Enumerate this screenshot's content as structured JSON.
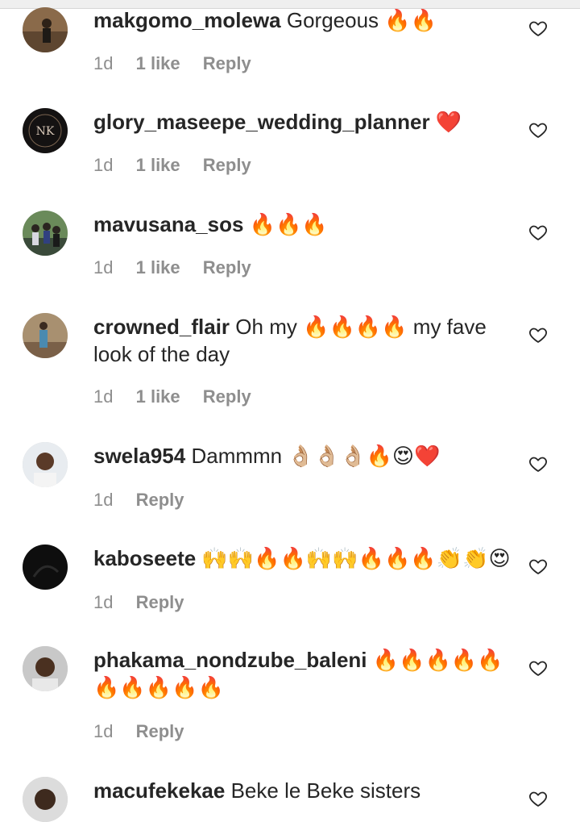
{
  "comments": [
    {
      "username": "makgomo_molewa",
      "text": "Gorgeous 🔥🔥",
      "time": "1d",
      "likes": "1 like",
      "reply_label": "Reply",
      "avatar": "person-outdoors-avatar"
    },
    {
      "username": "glory_maseepe_wedding_planner",
      "text": "❤️",
      "time": "1d",
      "likes": "1 like",
      "reply_label": "Reply",
      "avatar": "nk-logo-avatar"
    },
    {
      "username": "mavusana_sos",
      "text": "🔥🔥🔥",
      "time": "1d",
      "likes": "1 like",
      "reply_label": "Reply",
      "avatar": "group-photo-avatar"
    },
    {
      "username": "crowned_flair",
      "text": "Oh my 🔥🔥🔥🔥 my fave look of the day",
      "time": "1d",
      "likes": "1 like",
      "reply_label": "Reply",
      "avatar": "person-standing-avatar"
    },
    {
      "username": "swela954",
      "text": "Dammmn 👌🏼👌🏼👌🏼🔥😍❤️",
      "time": "1d",
      "likes": "",
      "reply_label": "Reply",
      "avatar": "portrait-avatar"
    },
    {
      "username": "kaboseete",
      "text": "🙌🙌🔥🔥🙌🙌🔥🔥🔥👏👏😍",
      "time": "1d",
      "likes": "",
      "reply_label": "Reply",
      "avatar": "dark-avatar"
    },
    {
      "username": "phakama_nondzube_baleni",
      "text": "🔥🔥🔥🔥🔥 🔥🔥🔥🔥🔥",
      "time": "1d",
      "likes": "",
      "reply_label": "Reply",
      "avatar": "face-avatar"
    },
    {
      "username": "macufekekae",
      "text": "Beke le Beke sisters",
      "time": "",
      "likes": "",
      "reply_label": "",
      "avatar": "face-avatar-2"
    }
  ],
  "icons": {
    "like": "heart-outline-icon"
  },
  "colors": {
    "text": "#262626",
    "meta": "#8e8e8e",
    "background": "#ffffff"
  }
}
